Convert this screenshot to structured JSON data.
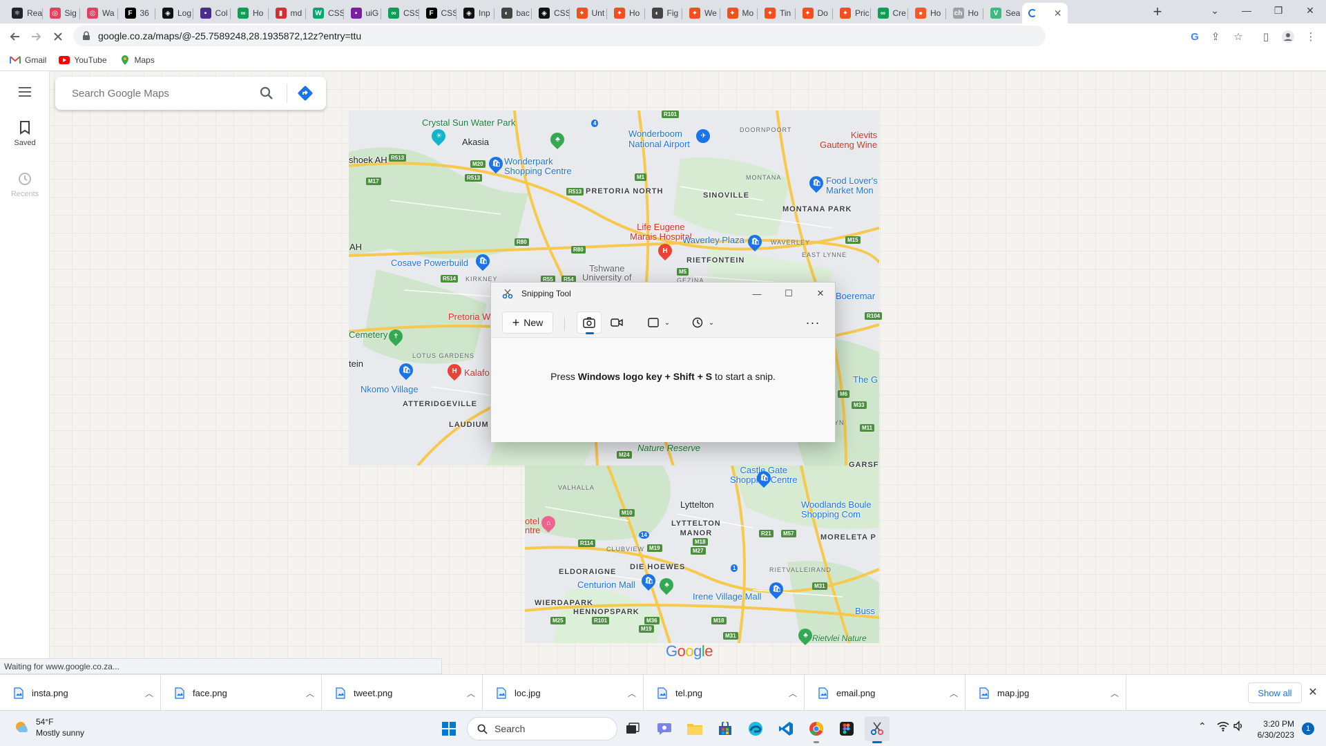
{
  "browser": {
    "tabs": [
      {
        "title": "Rea",
        "color": "#20232a",
        "glyph": "⚛"
      },
      {
        "title": "Sig",
        "color": "#e4405f",
        "glyph": "◎"
      },
      {
        "title": "Wa",
        "color": "#e4405f",
        "glyph": "◎"
      },
      {
        "title": "36",
        "color": "#000000",
        "glyph": "F"
      },
      {
        "title": "Log",
        "color": "#111111",
        "glyph": "◈"
      },
      {
        "title": "Col",
        "color": "#4a2d8c",
        "glyph": "▪"
      },
      {
        "title": "Ho",
        "color": "#0f9d58",
        "glyph": "∞"
      },
      {
        "title": "md",
        "color": "#d32f2f",
        "glyph": "▮"
      },
      {
        "title": "CSS",
        "color": "#04aa6d",
        "glyph": "W"
      },
      {
        "title": "uiG",
        "color": "#7b1fa2",
        "glyph": "▪"
      },
      {
        "title": "CSS",
        "color": "#0f9d58",
        "glyph": "∞"
      },
      {
        "title": "CSS",
        "color": "#000000",
        "glyph": "F"
      },
      {
        "title": "Inp",
        "color": "#111111",
        "glyph": "◈"
      },
      {
        "title": "bac",
        "color": "#444444",
        "glyph": "◐"
      },
      {
        "title": "CSS",
        "color": "#111111",
        "glyph": "◈"
      },
      {
        "title": "Unt",
        "color": "#f24e1e",
        "glyph": "✦"
      },
      {
        "title": "Ho",
        "color": "#f24e1e",
        "glyph": "✦"
      },
      {
        "title": "Fig",
        "color": "#444444",
        "glyph": "◐"
      },
      {
        "title": "We",
        "color": "#f24e1e",
        "glyph": "✦"
      },
      {
        "title": "Mo",
        "color": "#f24e1e",
        "glyph": "✦"
      },
      {
        "title": "Tin",
        "color": "#f24e1e",
        "glyph": "✦"
      },
      {
        "title": "Do",
        "color": "#f24e1e",
        "glyph": "✦"
      },
      {
        "title": "Pric",
        "color": "#f24e1e",
        "glyph": "✦"
      },
      {
        "title": "Cre",
        "color": "#0f9d58",
        "glyph": "∞"
      },
      {
        "title": "Ho",
        "color": "#ff5722",
        "glyph": "●"
      },
      {
        "title": "Ho",
        "color": "#9aa0a6",
        "glyph": "ch"
      },
      {
        "title": "Sea",
        "color": "#41b883",
        "glyph": "V"
      }
    ],
    "url": "google.co.za/maps/@-25.7589248,28.1935872,12z?entry=ttu",
    "bookmarks": [
      {
        "label": "Gmail"
      },
      {
        "label": "YouTube"
      },
      {
        "label": "Maps"
      }
    ],
    "status_text": "Waiting for www.google.co.za..."
  },
  "maps": {
    "search_placeholder": "Search Google Maps",
    "rail": {
      "saved": "Saved",
      "recents": "Recents"
    },
    "logo": "Google",
    "labels": {
      "crystal_sun": "Crystal Sun Water Park",
      "akasia": "Akasia",
      "shoek": "shoek AH",
      "wonderpark": "Wonderpark\nShopping Centre",
      "wonderboom": "Wonderboom\nNational Airport",
      "doornpoort": "DOORNPOORT",
      "kievits": "Kievits\nGauteng Wine",
      "pretoria_north": "PRETORIA NORTH",
      "sinoville": "SINOVILLE",
      "montana": "MONTANA",
      "food_lovers": "Food Lover's\nMarket Mon",
      "montana_park": "MONTANA PARK",
      "life_eugene": "Life Eugene\nMarais Hospital",
      "waverley_plaza": "Waverley Plaza",
      "waverley": "WAVERLEY",
      "east_lynne": "EAST LYNNE",
      "ah": "AH",
      "cosave": "Cosave Powerbuild",
      "rietfontein": "RIETFONTEIN",
      "tshwane": "Tshwane\nUniversity of",
      "kirkney": "KIRKNEY",
      "gezina": "GEZINA",
      "boeremar": "Boeremar",
      "pretoria_w": "Pretoria W",
      "cemetery": "Cemetery",
      "lotus_gardens": "LOTUS GARDENS",
      "tein": "tein",
      "kalafong": "Kalafo",
      "nkomo": "Nkomo Village",
      "atteridgeville": "ATTERIDGEVILLE",
      "laudium": "LAUDIUM",
      "the_g": "The G",
      "yn": "YN",
      "nature_reserve": "Nature Reserve",
      "castle_gate": "Castle Gate\nShopping Centre",
      "garsf": "GARSF",
      "valhalla": "VALHALLA",
      "lyttelton": "Lyttelton",
      "woodlands": "Woodlands Boule\nShopping Com",
      "otel_ntre": "otel\nntre",
      "lyttelton_manor": "LYTTELTON\nMANOR",
      "moreleta": "MORELETA P",
      "clubview": "CLUBVIEW",
      "die_hoewes": "DIE HOEWES",
      "rietvalleirand": "RIETVALLEIRAND",
      "eldoraigne": "ELDORAIGNE",
      "centurion_mall": "Centurion Mall",
      "irene": "Irene Village Mall",
      "wierdapark": "WIERDAPARK",
      "hennopspark": "HENNOPSPARK",
      "buss": "Buss",
      "rietvlei": "Rietvlei Nature"
    },
    "shields": [
      "R101",
      "4",
      "R513",
      "M20",
      "R513",
      "M17",
      "M1",
      "R513",
      "M15",
      "R80",
      "R80",
      "R514",
      "R55",
      "R54",
      "M5",
      "R104",
      "M6",
      "M33",
      "M11",
      "M24",
      "M10",
      "14",
      "R21",
      "M57",
      "R114",
      "M19",
      "M27",
      "M18",
      "1",
      "M31",
      "M25",
      "R101",
      "M36",
      "M19",
      "M18",
      "M31"
    ]
  },
  "snipping_tool": {
    "title": "Snipping Tool",
    "new_label": "New",
    "message_pre": "Press ",
    "message_bold": "Windows logo key + Shift + S",
    "message_post": " to start a snip."
  },
  "downloads": [
    {
      "name": "insta.png"
    },
    {
      "name": "face.png"
    },
    {
      "name": "tweet.png"
    },
    {
      "name": "loc.jpg"
    },
    {
      "name": "tel.png"
    },
    {
      "name": "email.png"
    },
    {
      "name": "map.jpg"
    }
  ],
  "downloads_show_all": "Show all",
  "taskbar": {
    "weather_temp": "54°F",
    "weather_desc": "Mostly sunny",
    "search_label": "Search",
    "time": "3:20 PM",
    "date": "6/30/2023",
    "notification_count": "1"
  },
  "colors": {
    "accent": "#1a73e8",
    "map_road": "#f6c84c",
    "map_green": "#c8e6c9",
    "snip_indicator": "#0067c0"
  }
}
